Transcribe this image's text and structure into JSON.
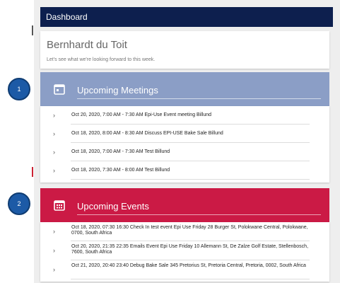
{
  "header": {
    "title": "Dashboard"
  },
  "profile": {
    "name": "Bernhardt du Toit",
    "subtitle": "Let's see what we're looking forward to this week."
  },
  "meetings": {
    "title": "Upcoming Meetings",
    "icon": "calendar-icon",
    "color": "#8b9ec6",
    "items": [
      "Oct 20, 2020, 7:00 AM - 7:30 AM Epi-Use Event meeting Billund",
      "Oct 18, 2020, 8:00 AM - 8:30 AM Discuss EPI-USE Bake Sale Billund",
      "Oct 18, 2020, 7:00 AM - 7:30 AM Test Billund",
      "Oct 18, 2020, 7:30 AM - 8:00 AM Test Billund"
    ]
  },
  "events": {
    "title": "Upcoming Events",
    "icon": "calendar-grid-icon",
    "color": "#cb1a45",
    "items": [
      "Oct 18, 2020, 07:30 16:30 Check In test event Epi Use Friday 28 Burger St, Polokwane Central, Polokwane, 0700, South Africa",
      "Oct 20, 2020, 21:35 22:35 Emails Event Epi Use Friday 10 Allemann St, De Zalze Golf Estate, Stellenbosch, 7600, South Africa",
      "Oct 21, 2020, 20:40 23:40 Debug Bake Sale 345 Pretorius St, Pretoria Central, Pretoria, 0002, South Africa"
    ]
  },
  "badges": {
    "one": "1",
    "two": "2"
  }
}
